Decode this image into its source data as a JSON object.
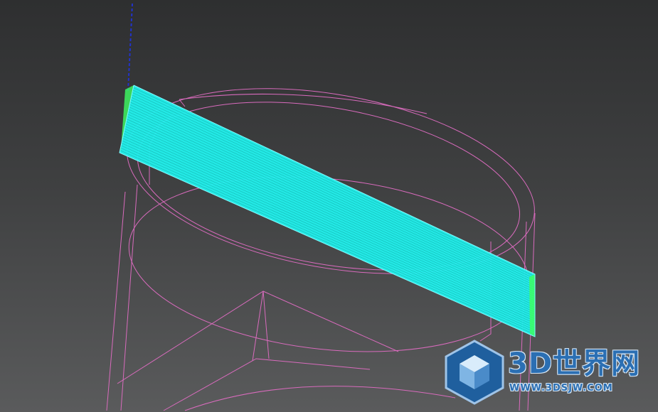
{
  "viewport": {
    "background_top": "#2e2f30",
    "background_bottom": "#5a5b5c",
    "wireframe_color": "#d96bbd",
    "selected_fill": "#22f2ee",
    "selected_edge": "#3dff63",
    "axis_color": "#2233cc"
  },
  "watermark": {
    "title": "3D世界网",
    "url": "WWW.3DSJW.COM",
    "brand_color": "#2b6fb3",
    "logo_icon": "cube-hexagon-icon"
  }
}
